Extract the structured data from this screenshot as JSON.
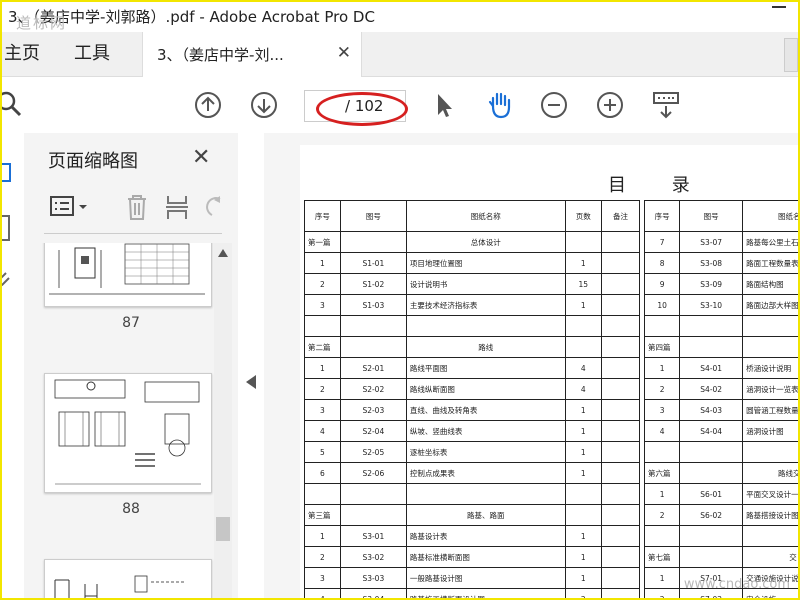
{
  "window": {
    "title": "3、（姜店中学-刘郭路）.pdf - Adobe Acrobat Pro DC",
    "watermark": "道标网"
  },
  "tabs": {
    "home": "主页",
    "tools": "工具",
    "document": "3、（姜店中学-刘...",
    "close_symbol": "✕"
  },
  "toolbar": {
    "page_input": "",
    "page_total": "/ 102"
  },
  "panel": {
    "title": "页面缩略图",
    "close_symbol": "✕",
    "thumbnails": [
      {
        "label": "87"
      },
      {
        "label": "88"
      }
    ]
  },
  "document": {
    "title": "目 录",
    "headers": [
      "序号",
      "图号",
      "图纸名称",
      "页数",
      "备注"
    ],
    "left_rows": [
      {
        "type": "section",
        "seq": "第一篇",
        "name": "总体设计"
      },
      {
        "seq": "1",
        "code": "S1-01",
        "name": "项目地理位置图",
        "pages": "1"
      },
      {
        "seq": "2",
        "code": "S1-02",
        "name": "设计说明书",
        "pages": "15"
      },
      {
        "seq": "3",
        "code": "S1-03",
        "name": "主要技术经济指标表",
        "pages": "1"
      },
      {
        "type": "blank"
      },
      {
        "type": "section",
        "seq": "第二篇",
        "name": "路线"
      },
      {
        "seq": "1",
        "code": "S2-01",
        "name": "路线平面图",
        "pages": "4"
      },
      {
        "seq": "2",
        "code": "S2-02",
        "name": "路线纵断面图",
        "pages": "4"
      },
      {
        "seq": "3",
        "code": "S2-03",
        "name": "直线、曲线及转角表",
        "pages": "1"
      },
      {
        "seq": "4",
        "code": "S2-04",
        "name": "纵坡、竖曲线表",
        "pages": "1"
      },
      {
        "seq": "5",
        "code": "S2-05",
        "name": "逐桩坐标表",
        "pages": "1"
      },
      {
        "seq": "6",
        "code": "S2-06",
        "name": "控制点成果表",
        "pages": "1"
      },
      {
        "type": "blank"
      },
      {
        "type": "section",
        "seq": "第三篇",
        "name": "路基、路面"
      },
      {
        "seq": "1",
        "code": "S3-01",
        "name": "路基设计表",
        "pages": "1"
      },
      {
        "seq": "2",
        "code": "S3-02",
        "name": "路基标准横断面图",
        "pages": "1"
      },
      {
        "seq": "3",
        "code": "S3-03",
        "name": "一般路基设计图",
        "pages": "1"
      },
      {
        "seq": "4",
        "code": "S3-04",
        "name": "路基施工横断面设计图",
        "pages": "2"
      }
    ],
    "right_rows": [
      {
        "seq": "7",
        "code": "S3-07",
        "name": "路基每公里土石"
      },
      {
        "seq": "8",
        "code": "S3-08",
        "name": "路面工程数量表"
      },
      {
        "seq": "9",
        "code": "S3-09",
        "name": "路面结构图"
      },
      {
        "seq": "10",
        "code": "S3-10",
        "name": "路面边部大样图"
      },
      {
        "type": "blank"
      },
      {
        "type": "section",
        "seq": "第四篇",
        "name": ""
      },
      {
        "seq": "1",
        "code": "S4-01",
        "name": "桥涵设计说明"
      },
      {
        "seq": "2",
        "code": "S4-02",
        "name": "涵洞设计一览表"
      },
      {
        "seq": "3",
        "code": "S4-03",
        "name": "圆管涵工程数量表"
      },
      {
        "seq": "4",
        "code": "S4-04",
        "name": "涵洞设计图"
      },
      {
        "type": "blank"
      },
      {
        "type": "section",
        "seq": "第六篇",
        "name": "路线交叉"
      },
      {
        "seq": "1",
        "code": "S6-01",
        "name": "平面交叉设计一"
      },
      {
        "seq": "2",
        "code": "S6-02",
        "name": "路基搭接设计图"
      },
      {
        "type": "blank"
      },
      {
        "type": "section",
        "seq": "第七篇",
        "name": "交"
      },
      {
        "seq": "1",
        "code": "S7-01",
        "name": "交通设施设计说"
      },
      {
        "seq": "2",
        "code": "S7-02",
        "name": "安全设施"
      }
    ],
    "bottom_watermark": "www.cndao.com"
  }
}
